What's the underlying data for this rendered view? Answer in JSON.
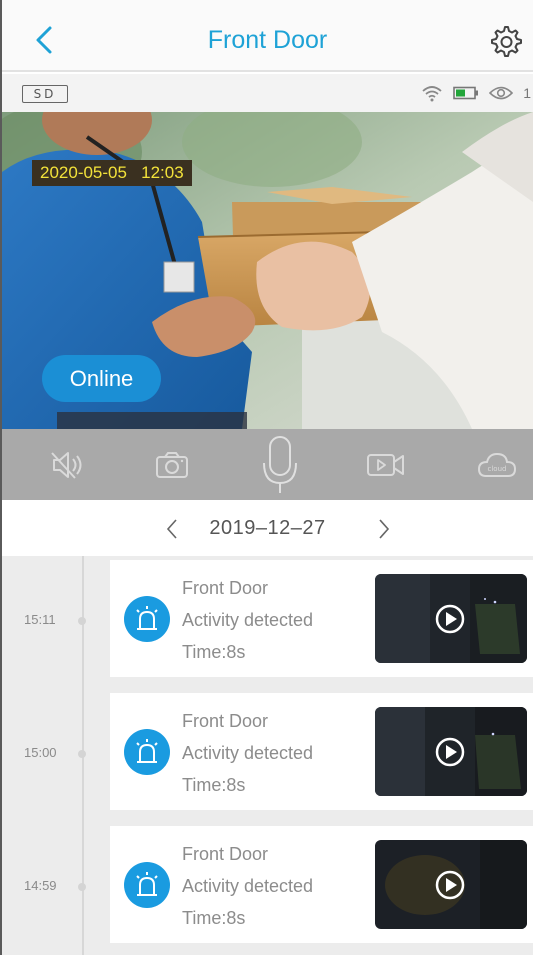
{
  "header": {
    "title": "Front Door",
    "back_icon": "chevron-left-icon",
    "settings_icon": "gear-icon"
  },
  "status": {
    "storage": "SD",
    "viewer_count": "1",
    "icons": [
      "wifi-icon",
      "battery-icon",
      "eye-icon"
    ]
  },
  "video": {
    "timestamp": "2020-05-05   12:03",
    "connection_status": "Online"
  },
  "controls": [
    {
      "name": "mute",
      "icon": "speaker-muted-icon"
    },
    {
      "name": "snapshot",
      "icon": "camera-icon"
    },
    {
      "name": "talk",
      "icon": "microphone-icon"
    },
    {
      "name": "record",
      "icon": "video-record-icon"
    },
    {
      "name": "cloud",
      "icon": "cloud-icon",
      "text": "cloud"
    }
  ],
  "date_nav": {
    "date": "2019–12–27",
    "prev_icon": "chevron-left-icon",
    "next_icon": "chevron-right-icon"
  },
  "events": [
    {
      "time": "15:11",
      "device": "Front Door",
      "event": "Activity detected",
      "duration": "Time:8s"
    },
    {
      "time": "15:00",
      "device": "Front Door",
      "event": "Activity detected",
      "duration": "Time:8s"
    },
    {
      "time": "14:59",
      "device": "Front Door",
      "event": "Activity detected",
      "duration": "Time:8s"
    }
  ],
  "colors": {
    "accent": "#1ea2d6",
    "online_badge": "#1b8fd5",
    "timestamp_text": "#f3e23a",
    "controls_bg": "#a9a9a9"
  }
}
